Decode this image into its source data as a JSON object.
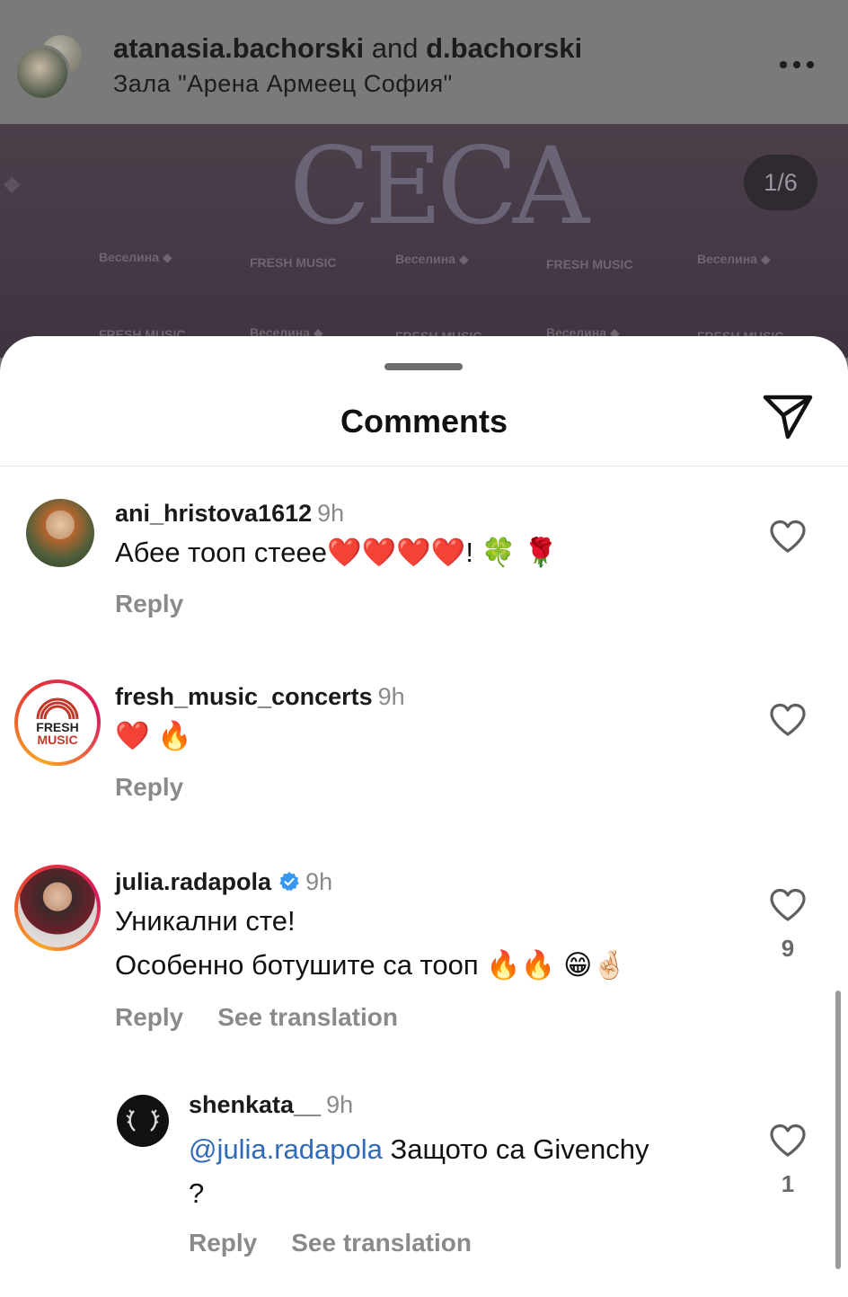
{
  "post": {
    "users_part1": "atanasia.bachorski",
    "users_and": "and",
    "users_part2": "d.bachorski",
    "location": "Зала \"Арена Армеец София\"",
    "more_icon": "more-horizontal-icon",
    "image_brand": "CECA",
    "image_counter": "1/6"
  },
  "sheet": {
    "title": "Comments",
    "share_icon": "send-icon"
  },
  "comments": [
    {
      "username": "ani_hristova1612",
      "time": "9h",
      "text": "Абее тооп стеее❤️❤️❤️❤️! 🍀 🌹",
      "reply": "Reply",
      "like_icon": "heart-outline-icon"
    },
    {
      "username": "fresh_music_concerts",
      "time": "9h",
      "text": "❤️ 🔥",
      "reply": "Reply",
      "avatar_line1": "FRESH",
      "avatar_line2": "MUSIC",
      "like_icon": "heart-outline-icon"
    },
    {
      "username": "julia.radapola",
      "time": "9h",
      "verified": true,
      "text_line1": "Уникални сте!",
      "text_line2": "Особенно ботушите са тооп 🔥🔥 😁🤞🏻",
      "reply": "Reply",
      "see_translation": "See translation",
      "like_icon": "heart-outline-icon",
      "likes": "9"
    },
    {
      "username": "shenkata__",
      "time": "9h",
      "mention": "@julia.radapola",
      "text_rest": " Защото са Givenchy",
      "text_line2": "?",
      "reply": "Reply",
      "see_translation": "See translation",
      "like_icon": "heart-outline-icon",
      "likes": "1"
    }
  ],
  "colors": {
    "mention": "#2f6ab8",
    "secondary_text": "#8a8a8a",
    "verified": "#3897f0"
  }
}
